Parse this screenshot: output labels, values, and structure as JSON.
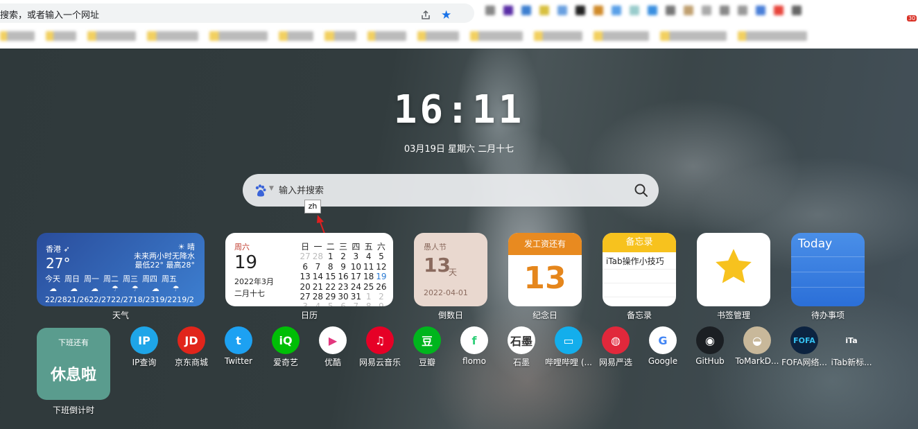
{
  "browser": {
    "omnibox_placeholder": "搜索，或者输入一个网址",
    "share_icon": "share-icon",
    "star_icon": "bookmark-star-icon",
    "extension_badge": "30"
  },
  "clock": {
    "time": "16:11",
    "date": "03月19日 星期六 二月十七"
  },
  "search": {
    "placeholder": "输入并搜索",
    "engine_icon": "baidu-paw-icon",
    "ime_indicator": "zh"
  },
  "widgets": {
    "weather": {
      "city": "香港",
      "temp": "27°",
      "condition": "晴",
      "note_line1": "未来两小时无降水",
      "note_line2": "最低22° 最高28°",
      "days": [
        "今天",
        "周日",
        "周一",
        "周二",
        "周三",
        "周四",
        "周五"
      ],
      "temps": "22/2821/2622/2722/2718/2319/2219/2",
      "label": "天气"
    },
    "calendar": {
      "weekday": "周六",
      "day": "19",
      "year_month": "2022年3月",
      "lunar": "二月十七",
      "weekday_headers": [
        "日",
        "一",
        "二",
        "三",
        "四",
        "五",
        "六"
      ],
      "label": "日历"
    },
    "countdown": {
      "title": "愚人节",
      "number": "13",
      "unit": "天",
      "date": "2022-04-01",
      "label": "倒数日"
    },
    "anniversary": {
      "title": "发工资还有",
      "number": "13",
      "label": "纪念日"
    },
    "memo": {
      "title": "备忘录",
      "content": "iTab操作小技巧",
      "label": "备忘录"
    },
    "bookmark_manager": {
      "label": "书签管理"
    },
    "todo": {
      "title": "Today",
      "label": "待办事项"
    },
    "off_work": {
      "top": "下班还有",
      "main": "休息啦",
      "label": "下班倒计时"
    }
  },
  "apps": [
    {
      "name": "IP查询",
      "bg": "#1ea5e8",
      "glyph": "IP",
      "color": "#ffffff"
    },
    {
      "name": "京东商城",
      "bg": "#e1251b",
      "glyph": "JD",
      "color": "#ffffff"
    },
    {
      "name": "Twitter",
      "bg": "#1da1f2",
      "glyph": "t",
      "color": "#ffffff"
    },
    {
      "name": "爱奇艺",
      "bg": "#00be06",
      "glyph": "iQ",
      "color": "#ffffff"
    },
    {
      "name": "优酷",
      "bg": "#ffffff",
      "glyph": "▶",
      "color": "#e3387e"
    },
    {
      "name": "网易云音乐",
      "bg": "#e60026",
      "glyph": "♫",
      "color": "#ffffff"
    },
    {
      "name": "豆瓣",
      "bg": "#00b51d",
      "glyph": "豆",
      "color": "#ffffff"
    },
    {
      "name": "flomo",
      "bg": "#ffffff",
      "glyph": "f",
      "color": "#30cf79"
    },
    {
      "name": "石墨",
      "bg": "#ffffff",
      "glyph": "石墨",
      "color": "#333333"
    },
    {
      "name": "哔哩哔哩 (...",
      "bg": "#13aeec",
      "glyph": "▭",
      "color": "#ffffff"
    },
    {
      "name": "网易严选",
      "bg": "#e1283b",
      "glyph": "◍",
      "color": "#ffffff"
    },
    {
      "name": "Google",
      "bg": "#ffffff",
      "glyph": "G",
      "color": "#4285f4"
    },
    {
      "name": "GitHub",
      "bg": "#1b1f23",
      "glyph": "◉",
      "color": "#ffffff"
    },
    {
      "name": "ToMarkD...",
      "bg": "#c8b89a",
      "glyph": "◒",
      "color": "#ffffff"
    },
    {
      "name": "FOFA网络...",
      "bg": "#0c2340",
      "glyph": "FOFA",
      "color": "#35c3f3"
    },
    {
      "name": "iTab新标...",
      "bg": "transparent",
      "glyph": "iTa",
      "color": "#ffffff"
    }
  ]
}
